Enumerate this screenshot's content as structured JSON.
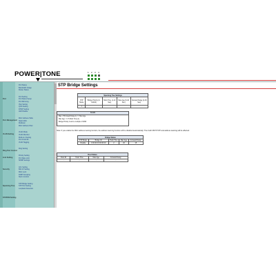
{
  "header": {
    "logo": "POWER|TONE",
    "port_numbers": [
      "1",
      "2",
      "3",
      "4"
    ],
    "port_status": [
      true,
      true,
      true,
      false,
      true,
      true,
      true,
      true
    ]
  },
  "sidebar": {
    "groups": [
      {
        "label": "",
        "items": [
          "Port Status",
          "Bandwidth Usage",
          "Router Status"
        ]
      },
      {
        "label": "Port",
        "items": [
          "Port Setting",
          "Port Status Setup",
          "Port Mirroring",
          "Vlan Setting",
          "QOS Setting",
          "DHCP Setting",
          "LED Disable"
        ]
      },
      {
        "label": "Port Management",
        "items": [
          "MAC Address Table",
          "Static MAC",
          "Multicast",
          "MAC Address Filter"
        ]
      },
      {
        "label": "VLAN Setting",
        "items": [
          "VLAN Mode",
          "VLAN Member",
          "Multi-to-1 Setting",
          "Port VLAN ID",
          "VLAN Tagging"
        ]
      },
      {
        "label": "Ring Port Control",
        "items": [
          "Ring Setting"
        ]
      },
      {
        "label": "Link Setting",
        "items": [
          "Priority Setting",
          "Port Rate Limit",
          "SNMP Settings"
        ]
      },
      {
        "label": "Security",
        "items": [
          "ACL Setting",
          "802.1X Setting",
          "MAC Lock",
          "IGMP Snooping",
          "Storm Control"
        ]
      },
      {
        "label": "Spanning Tree",
        "items": [
          "STP Bridge Setting",
          "STP Port Setting",
          "Loopback Detection"
        ]
      },
      {
        "label": "SYSTEM Setting",
        "items": []
      }
    ]
  },
  "main": {
    "title": "STP Bridge Settings",
    "stp_table": {
      "caption": "Spanning Tree Settings",
      "headers": [
        "STP Mode",
        "Bridge Priority (0-61440)",
        "Hello Time (1-10 Sec)",
        "Max Age (6-40 Sec)",
        "Forward Delay (4-30 Sec)"
      ],
      "values": [
        "",
        "",
        "",
        "",
        ""
      ],
      "select_value": "1"
    },
    "params": {
      "label": "Details",
      "lines": [
        "Max. 2*(Forward Delay-1) >= Max Age",
        "Max Age >= 2*(Hello Time+1)",
        "Bridge Priority must be multiple of 4096"
      ]
    },
    "note": "Note: If you enable the MAC address leaning function, the address learning function will be disabled automatically. Then both RSTP STP and address learning will be affected.",
    "bridge_status": {
      "caption": "Bridge Status",
      "headers": [
        "STP Mode",
        "Bridge ID",
        "Hello Time",
        "Max Age",
        "Forward Delay"
      ],
      "row": [
        "Disable",
        "0 00 00 00 00 00 00",
        "2",
        "20",
        "15"
      ]
    },
    "root_status": {
      "caption": "Root Status",
      "headers": [
        "Root ID",
        "Hello Time",
        "Max Age",
        "Forward Delay"
      ],
      "row": [
        "--",
        "--",
        "--",
        "--"
      ]
    }
  }
}
